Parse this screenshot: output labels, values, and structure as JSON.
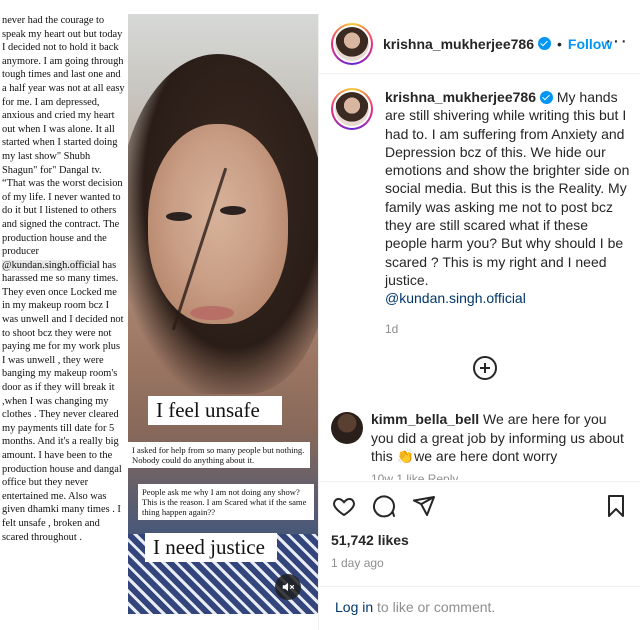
{
  "media": {
    "story_text_parts": [
      "never had the courage to speak my heart out but today I decided not to hold it back anymore. I am going through tough times and last one and a half year was not at all easy for me. I am depressed, anxious and cried my heart out when I was alone. It all started when I started doing my last show\" Shubh Shagun\" for\" Dangal tv. “That was the worst decision of my life. I never wanted to do it but I listened to others and signed the contract. The production house and the producer ",
      "@kundan.singh.official",
      " has harassed me so many times. They even once Locked me in my makeup room bcz I was unwell and I decided not to shoot bcz they were not paying me for my work plus I was unwell , they were banging my makeup room's door as if they will break it ,when I was changing my clothes . They never cleared my payments till date for 5 months. And it's a really big amount. I have been to the production house and dangal office but they never entertained me. Also was given dhamki many times . I felt unsafe , broken and scared throughout ."
    ],
    "label_feel_unsafe": "I feel unsafe",
    "label_asked_help": "I asked for help from so many people but nothing. Nobody could do anything about it.",
    "label_people_ask": "People ask me why I am not doing any show? This is the reason. I am Scared what if the same thing happen again??",
    "label_need_justice": "I need justice",
    "mute_icon": "speaker-muted-icon"
  },
  "header": {
    "username": "krishna_mukherjee786",
    "separator": "•",
    "follow_label": "Follow",
    "more_label": "···"
  },
  "caption": {
    "username": "krishna_mukherjee786",
    "text": " My hands are still shivering while writing this but I had to. I am suffering from Anxiety and Depression bcz of this. We hide our emotions and show the brighter side on social media. But this is the Reality. My family was asking me not to post bcz they are still scared what if these people harm you? But why should I be scared ? This is my right and I need justice.",
    "mention": "@kundan.singh.official",
    "time": "1d"
  },
  "comment": {
    "username": "kimm_bella_bell",
    "text_before_emoji": " We are here for you you did a great job by informing us about this ",
    "emoji": "👏",
    "text_after_emoji": "we are here dont worry",
    "meta": "10w   1 like   Reply"
  },
  "actions": {
    "icons": [
      "heart-icon",
      "comment-icon",
      "share-icon",
      "bookmark-icon"
    ],
    "likes": "51,742 likes",
    "posted_ago": "1 day ago"
  },
  "login": {
    "link": "Log in",
    "rest": " to like or comment."
  },
  "colors": {
    "accent": "#0095f6",
    "link": "#00376b",
    "muted": "#8e8e8e"
  }
}
